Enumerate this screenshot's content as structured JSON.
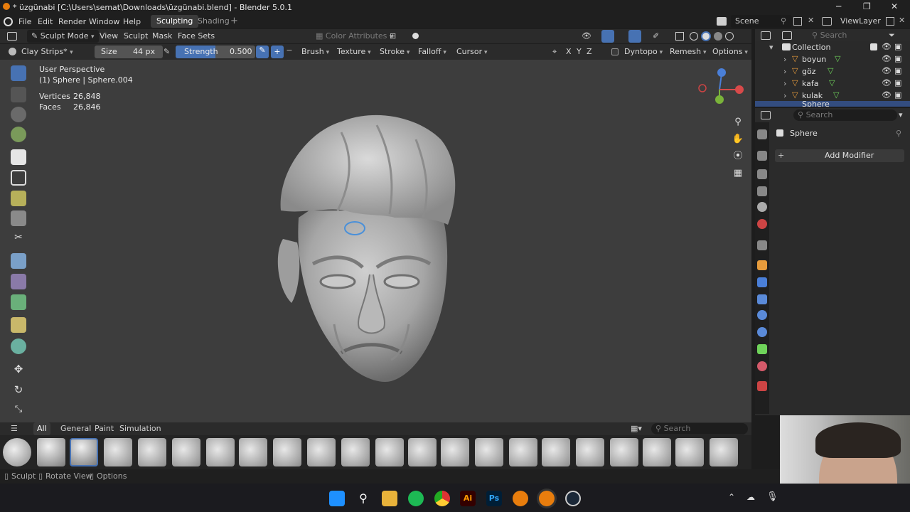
{
  "window": {
    "title": "* üzgünabi [C:\\Users\\semat\\Downloads\\üzgünabi.blend] - Blender 5.0.1"
  },
  "menubar": {
    "items": [
      "File",
      "Edit",
      "Render",
      "Window",
      "Help"
    ],
    "workspaces": [
      "Sculpting",
      "Shading"
    ],
    "active_workspace": "Sculpting",
    "scene": "Scene",
    "view_layer": "ViewLayer"
  },
  "header": {
    "mode": "Sculpt Mode",
    "menus": [
      "View",
      "Sculpt",
      "Mask",
      "Face Sets"
    ],
    "color_attributes": "Color Attributes"
  },
  "tool_settings": {
    "brush_name": "Clay Strips*",
    "size_label": "Size",
    "size_value": "44 px",
    "strength_label": "Strength",
    "strength_value": "0.500",
    "strength_fraction": 0.5,
    "menus": [
      "Brush",
      "Texture",
      "Stroke",
      "Falloff",
      "Cursor"
    ],
    "axes": [
      "X",
      "Y",
      "Z"
    ],
    "dyntopo": "Dyntopo",
    "remesh": "Remesh",
    "options": "Options"
  },
  "viewport": {
    "view_name": "User Perspective",
    "object_line": "(1) Sphere | Sphere.004",
    "stats": {
      "vertices_label": "Vertices",
      "vertices": "26,848",
      "faces_label": "Faces",
      "faces": "26,846"
    }
  },
  "shelf": {
    "tabs": [
      "All",
      "General",
      "Paint",
      "Simulation"
    ],
    "active_tab": "All",
    "search_placeholder": "Search"
  },
  "statusbar": {
    "items": [
      "Sculpt",
      "Rotate View",
      "Options"
    ]
  },
  "outliner": {
    "search_placeholder": "Search",
    "collection": "Collection",
    "items": [
      "boyun",
      "göz",
      "kafa",
      "kulak",
      "Sphere"
    ]
  },
  "properties": {
    "search_placeholder": "Search",
    "object_name": "Sphere",
    "add_modifier": "Add Modifier"
  },
  "taskbar": {
    "icons": [
      "windows-icon",
      "search-icon",
      "file-explorer-icon",
      "spotify-icon",
      "chrome-icon",
      "illustrator-icon",
      "photoshop-icon",
      "blender-icon",
      "blender-active-icon",
      "steam-icon"
    ],
    "ai_label": "Ai",
    "ps_label": "Ps"
  },
  "colors": {
    "accent": "#4772b3",
    "viewport_bg": "#3d3d3d",
    "header_bg": "#2b2b2b"
  }
}
